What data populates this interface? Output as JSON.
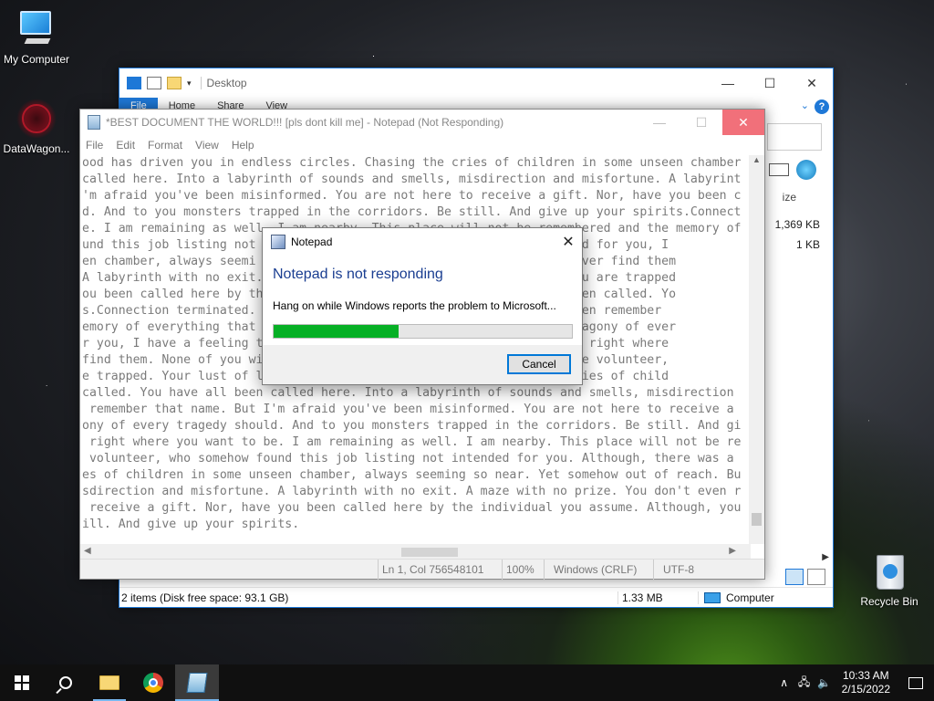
{
  "desktop": {
    "icons": [
      {
        "label": "My Computer"
      },
      {
        "label": "DataWagon..."
      },
      {
        "label": "Recycle Bin"
      }
    ]
  },
  "explorer": {
    "title": "Desktop",
    "tabs": [
      "File",
      "Home",
      "Share",
      "View"
    ],
    "column_size": "ize",
    "sizes": [
      "1,369 KB",
      "1 KB"
    ],
    "status_items": "2 items (Disk free space: 93.1 GB)",
    "status_size": "1.33 MB",
    "status_location": "Computer",
    "help": "?"
  },
  "notepad": {
    "title": "*BEST DOCUMENT THE WORLD!!! [pls dont kill me] - Notepad (Not Responding)",
    "menu": [
      "File",
      "Edit",
      "Format",
      "View",
      "Help"
    ],
    "lines": [
      "ood has driven you in endless circles. Chasing the cries of children in some unseen chamber",
      "called here. Into a labyrinth of sounds and smells, misdirection and misfortune. A labyrint",
      "'m afraid you've been misinformed. You are not here to receive a gift. Nor, have you been c",
      "d. And to you monsters trapped in the corridors. Be still. And give up your spirits.Connect",
      "e. I am remaining as well. I am nearby. This place will not be remembered and the memory of",
      "und this job listing not                                   out planned for you, I",
      "en chamber, always seemi                                   ou will never find them",
      "A labyrinth with no exit.                                  ze that you are trapped",
      "ou been called here by th                                   indeed been called. Yo",
      "s.Connection terminated.                                   u still even remember",
      "emory of everything that                                   y. As the agony of ever",
      "r you, I have a feeling t                                  at you are right where",
      "find them. None of you wi                                  u, my brave volunteer,",
      "e trapped. Your lust of l                                  ing the cries of child",
      "called. You have all been called here. Into a labyrinth of sounds and smells, misdirection",
      " remember that name. But I'm afraid you've been misinformed. You are not here to receive a",
      "ony of every tragedy should. And to you monsters trapped in the corridors. Be still. And gi",
      " right where you want to be. I am remaining as well. I am nearby. This place will not be re",
      " volunteer, who somehow found this job listing not intended for you. Although, there was a",
      "es of children in some unseen chamber, always seeming so near. Yet somehow out of reach. Bu",
      "sdirection and misfortune. A labyrinth with no exit. A maze with no prize. You don't even r",
      " receive a gift. Nor, have you been called here by the individual you assume. Although, you",
      "ill. And give up your spirits."
    ],
    "status": {
      "position": "Ln 1, Col 756548101",
      "zoom": "100%",
      "line_ending": "Windows (CRLF)",
      "encoding": "UTF-8"
    }
  },
  "dialog": {
    "title": "Notepad",
    "heading": "Notepad is not responding",
    "message": "Hang on while Windows reports the problem to Microsoft...",
    "progress_fraction": 0.42,
    "cancel_label": "Cancel",
    "close_glyph": "✕"
  },
  "taskbar": {
    "time": "10:33 AM",
    "date": "2/15/2022",
    "tray_chevron": "∧"
  }
}
